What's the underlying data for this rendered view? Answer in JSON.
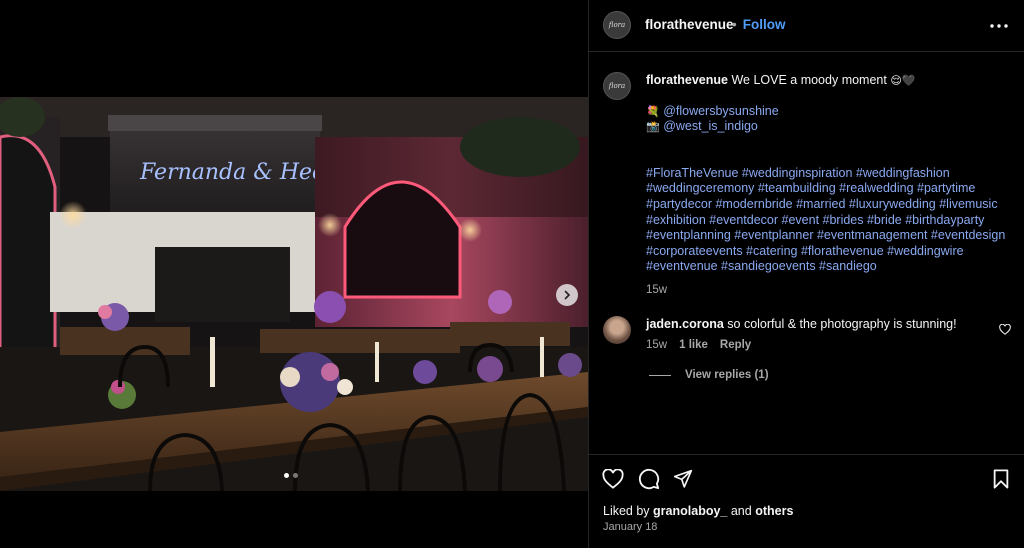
{
  "post": {
    "photo_sign_text": "Fernanda & Hector",
    "carousel": {
      "current": 1,
      "total": 2
    }
  },
  "header": {
    "avatar_text": "flora",
    "username": "florathevenue",
    "bullet": "•",
    "follow_label": "Follow"
  },
  "caption": {
    "avatar_text": "flora",
    "username": "florathevenue",
    "text": "We LOVE a moody moment",
    "emoji": "😌🖤",
    "credit1_icon": "💐",
    "credit1": "@flowersbysunshine",
    "credit2_icon": "📸",
    "credit2": "@west_is_indigo",
    "hashtags": "#FloraTheVenue #weddinginspiration #weddingfashion #weddingceremony #teambuilding #realwedding #partytime #partydecor #modernbride #married #luxurywedding #livemusic #exhibition #eventdecor #event #brides #bride #birthdayparty #eventplanning #eventplanner #eventmanagement #eventdesign #corporateevents #catering #florathevenue #weddingwire #eventvenue #sandiegoevents #sandiego",
    "time": "15w"
  },
  "comment": {
    "username": "jaden.corona",
    "text": "so colorful & the photography is stunning!",
    "time": "15w",
    "likes": "1 like",
    "reply_label": "Reply",
    "view_replies": "View replies (1)"
  },
  "footer": {
    "liked_prefix": "Liked by",
    "liked_user": "granolaboy_",
    "liked_and": "and",
    "liked_others": "others",
    "date": "January 18"
  },
  "colors": {
    "background": "#000000",
    "link_blue": "#4f9cf9",
    "hashtag_blue": "#8aa9f0",
    "muted": "#a8a8a8",
    "border": "#262626"
  },
  "icons": [
    "more-options-icon",
    "chevron-right-icon",
    "heart-icon",
    "comment-icon",
    "share-icon",
    "bookmark-icon"
  ]
}
